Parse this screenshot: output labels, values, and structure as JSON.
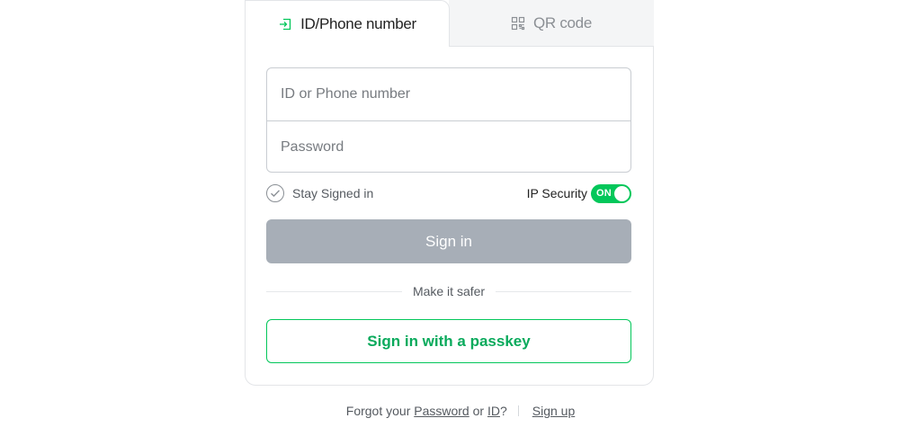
{
  "tabs": {
    "login": {
      "label": "ID/Phone number",
      "icon": "login-arrow-icon"
    },
    "qr": {
      "label": "QR code",
      "icon": "qr-code-icon"
    }
  },
  "form": {
    "id_placeholder": "ID or Phone number",
    "id_value": "",
    "password_placeholder": "Password",
    "password_value": ""
  },
  "options": {
    "stay_signed_in": "Stay Signed in",
    "stay_signed_in_checked": false,
    "ip_security_label": "IP Security",
    "ip_security_toggle": "ON",
    "ip_security_on": true
  },
  "buttons": {
    "sign_in": "Sign in",
    "passkey": "Sign in with a passkey"
  },
  "divider_text": "Make it safer",
  "footer": {
    "forgot_prefix": "Forgot your",
    "password_link": "Password",
    "or": "or",
    "id_link": "ID",
    "question": "?",
    "sign_up": "Sign up"
  },
  "colors": {
    "accent": "#03c75a",
    "passkey_text": "#09aa5c",
    "disabled_button": "#a7aeb7",
    "border": "#c9cdd2"
  }
}
